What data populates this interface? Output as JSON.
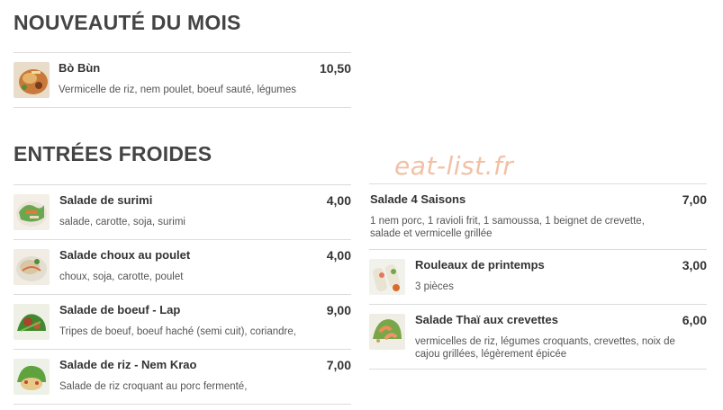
{
  "watermark": "eat-list.fr",
  "sections": {
    "nouveaute": {
      "title": "NOUVEAUTÉ DU MOIS",
      "items": [
        {
          "name": "Bò Bùn",
          "price": "10,50",
          "desc": "Vermicelle de riz, nem poulet, boeuf sauté, légumes",
          "thumb": "bo-bun-photo"
        }
      ]
    },
    "entrees": {
      "title": "ENTRÉES FROIDES",
      "left": [
        {
          "name": "Salade de surimi",
          "price": "4,00",
          "desc": "salade, carotte, soja, surimi",
          "thumb": "salad-surimi-photo"
        },
        {
          "name": "Salade choux au poulet",
          "price": "4,00",
          "desc": "choux, soja, carotte, poulet",
          "thumb": "cabbage-chicken-salad-photo"
        },
        {
          "name": "Salade de boeuf - Lap",
          "price": "9,00",
          "desc": "Tripes de boeuf, boeuf haché (semi cuit), coriandre,",
          "thumb": "beef-lap-salad-photo"
        },
        {
          "name": "Salade de riz - Nem Krao",
          "price": "7,00",
          "desc": "Salade de riz croquant au porc fermenté,",
          "thumb": "rice-salad-photo"
        }
      ],
      "right": [
        {
          "name": "Salade 4 Saisons",
          "price": "7,00",
          "desc": "1 nem porc, 1 ravioli frit, 1 samoussa, 1 beignet de crevette, salade et vermicelle grillée"
        },
        {
          "name": "Rouleaux de printemps",
          "price": "3,00",
          "desc": "3 pièces",
          "thumb": "spring-rolls-photo"
        },
        {
          "name": "Salade Thaï aux crevettes",
          "price": "6,00",
          "desc": "vermicelles de riz, légumes croquants, crevettes, noix de cajou grillées, légèrement épicée",
          "thumb": "thai-shrimp-salad-photo"
        }
      ]
    }
  }
}
